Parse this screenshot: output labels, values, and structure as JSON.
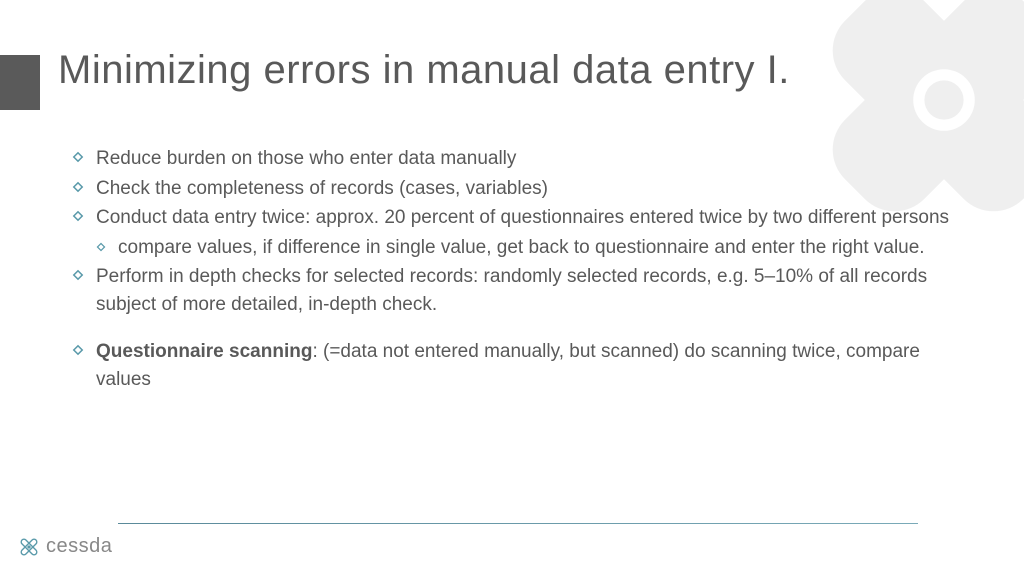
{
  "title": "Minimizing errors in manual data entry I.",
  "bullets": [
    {
      "text": "Reduce burden on those who enter data manually",
      "level": 0
    },
    {
      "text": "Check the completeness of records (cases, variables)",
      "level": 0
    },
    {
      "text": "Conduct data entry twice: approx. 20 percent of questionnaires entered twice by two different persons",
      "level": 0
    },
    {
      "text": "compare values, if difference in single value, get back to questionnaire and enter the right value.",
      "level": 1
    },
    {
      "text": "Perform in depth checks for selected records: randomly selected records, e.g. 5–10% of all records subject of more detailed, in-depth check.",
      "level": 0
    },
    {
      "text_bold": "Questionnaire scanning",
      "text_rest": ": (=data not entered manually, but scanned) do scanning twice,  compare values",
      "level": 0,
      "spaced": true
    }
  ],
  "logo_text": "cessda"
}
